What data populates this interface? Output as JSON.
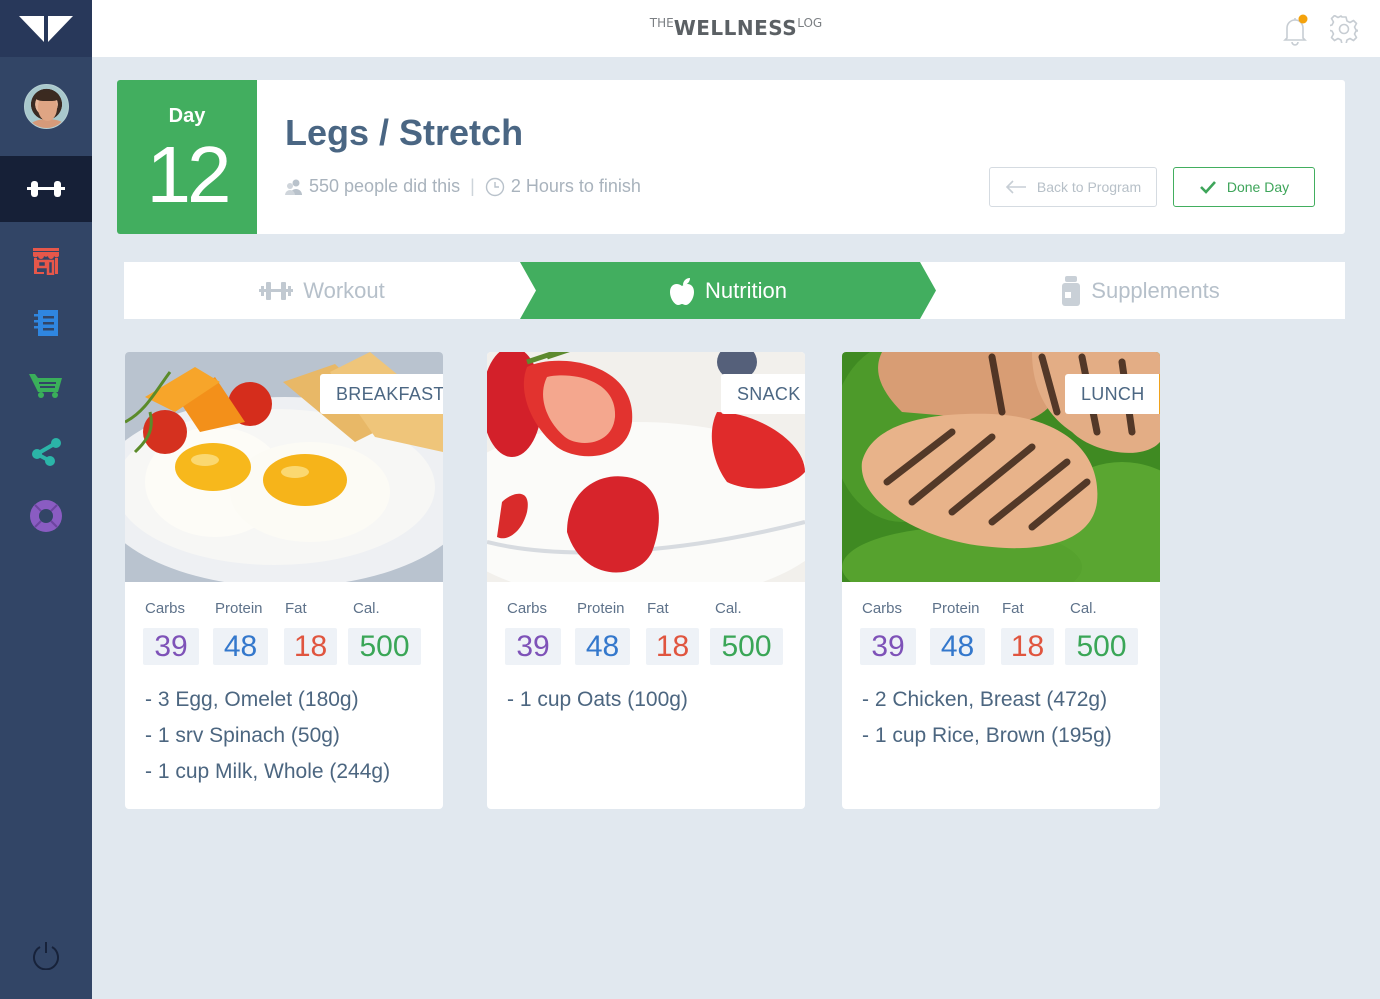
{
  "app": {
    "brand_prefix": "THE",
    "brand_main": "WELLNESS",
    "brand_suffix": "LOG"
  },
  "sidebar": {
    "items": [
      {
        "name": "workout",
        "icon": "dumbbell-icon",
        "color": "#ffffff",
        "active": true
      },
      {
        "name": "store",
        "icon": "store-icon",
        "color": "#e6574a",
        "active": false
      },
      {
        "name": "journal",
        "icon": "notebook-icon",
        "color": "#2f86e0",
        "active": false
      },
      {
        "name": "cart",
        "icon": "cart-icon",
        "color": "#3aaf5a",
        "active": false
      },
      {
        "name": "share",
        "icon": "share-icon",
        "color": "#2bb5a8",
        "active": false
      },
      {
        "name": "support",
        "icon": "lifebuoy-icon",
        "color": "#8a5cc2",
        "active": false
      }
    ],
    "power_icon": "power-icon"
  },
  "topbar": {
    "notification_dot_color": "#f4a20c"
  },
  "day": {
    "label": "Day",
    "number": "12",
    "title": "Legs / Stretch",
    "people": "550 people did this",
    "duration": "2 Hours to finish",
    "back_label": "Back to Program",
    "done_label": "Done Day"
  },
  "tabs": [
    {
      "label": "Workout",
      "icon": "dumbbell-icon",
      "active": false
    },
    {
      "label": "Nutrition",
      "icon": "apple-icon",
      "active": true
    },
    {
      "label": "Supplements",
      "icon": "pill-bottle-icon",
      "active": false
    }
  ],
  "macro_labels": {
    "carbs": "Carbs",
    "protein": "Protein",
    "fat": "Fat",
    "cal": "Cal."
  },
  "meals": [
    {
      "badge": "BREAKFAST",
      "carbs": "39",
      "protein": "48",
      "fat": "18",
      "cal": "500",
      "items": [
        "- 3 Egg, Omelet (180g)",
        "- 1 srv Spinach (50g)",
        "- 1 cup Milk, Whole (244g)"
      ]
    },
    {
      "badge": "SNACK",
      "carbs": "39",
      "protein": "48",
      "fat": "18",
      "cal": "500",
      "items": [
        "- 1 cup Oats (100g)"
      ]
    },
    {
      "badge": "LUNCH",
      "carbs": "39",
      "protein": "48",
      "fat": "18",
      "cal": "500",
      "items": [
        "- 2 Chicken, Breast (472g)",
        "- 1 cup Rice, Brown (195g)"
      ]
    }
  ]
}
